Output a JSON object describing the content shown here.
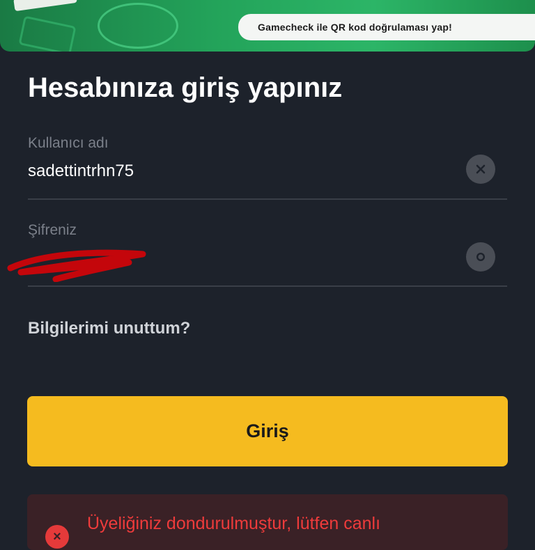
{
  "banner": {
    "text": "Gamecheck ile QR kod doğrulaması yap!"
  },
  "login": {
    "title": "Hesabınıza giriş yapınız",
    "username_label": "Kullanıcı adı",
    "username_value": "sadettintrhn75",
    "password_label": "Şifreniz",
    "forgot_label": "Bilgilerimi unuttum?",
    "submit_label": "Giriş"
  },
  "error": {
    "message": "Üyeliğiniz dondurulmuştur, lütfen canlı"
  },
  "colors": {
    "background": "#1d222b",
    "accent": "#f5bb1f",
    "banner": "#23a35a",
    "error": "#ee3b3b"
  }
}
